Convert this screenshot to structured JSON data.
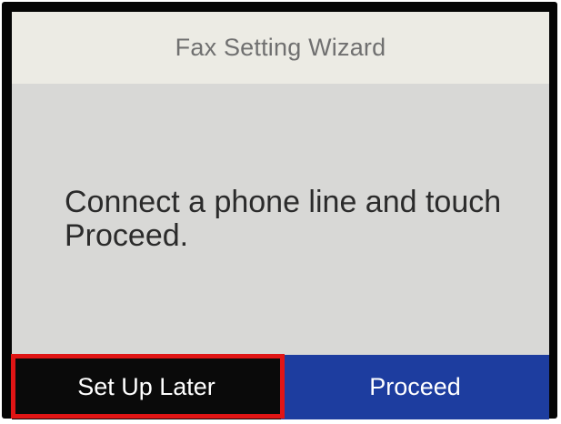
{
  "wizard": {
    "title": "Fax Setting Wizard",
    "message": "Connect a phone line and touch Proceed."
  },
  "buttons": {
    "set_up_later": "Set Up Later",
    "proceed": "Proceed"
  },
  "colors": {
    "title_bar": "#ecebe4",
    "screen_background": "#d8d8d6",
    "proceed_button": "#1d3d9f",
    "set_up_later_button": "#0a0a0a",
    "highlight_border": "#e01515"
  }
}
